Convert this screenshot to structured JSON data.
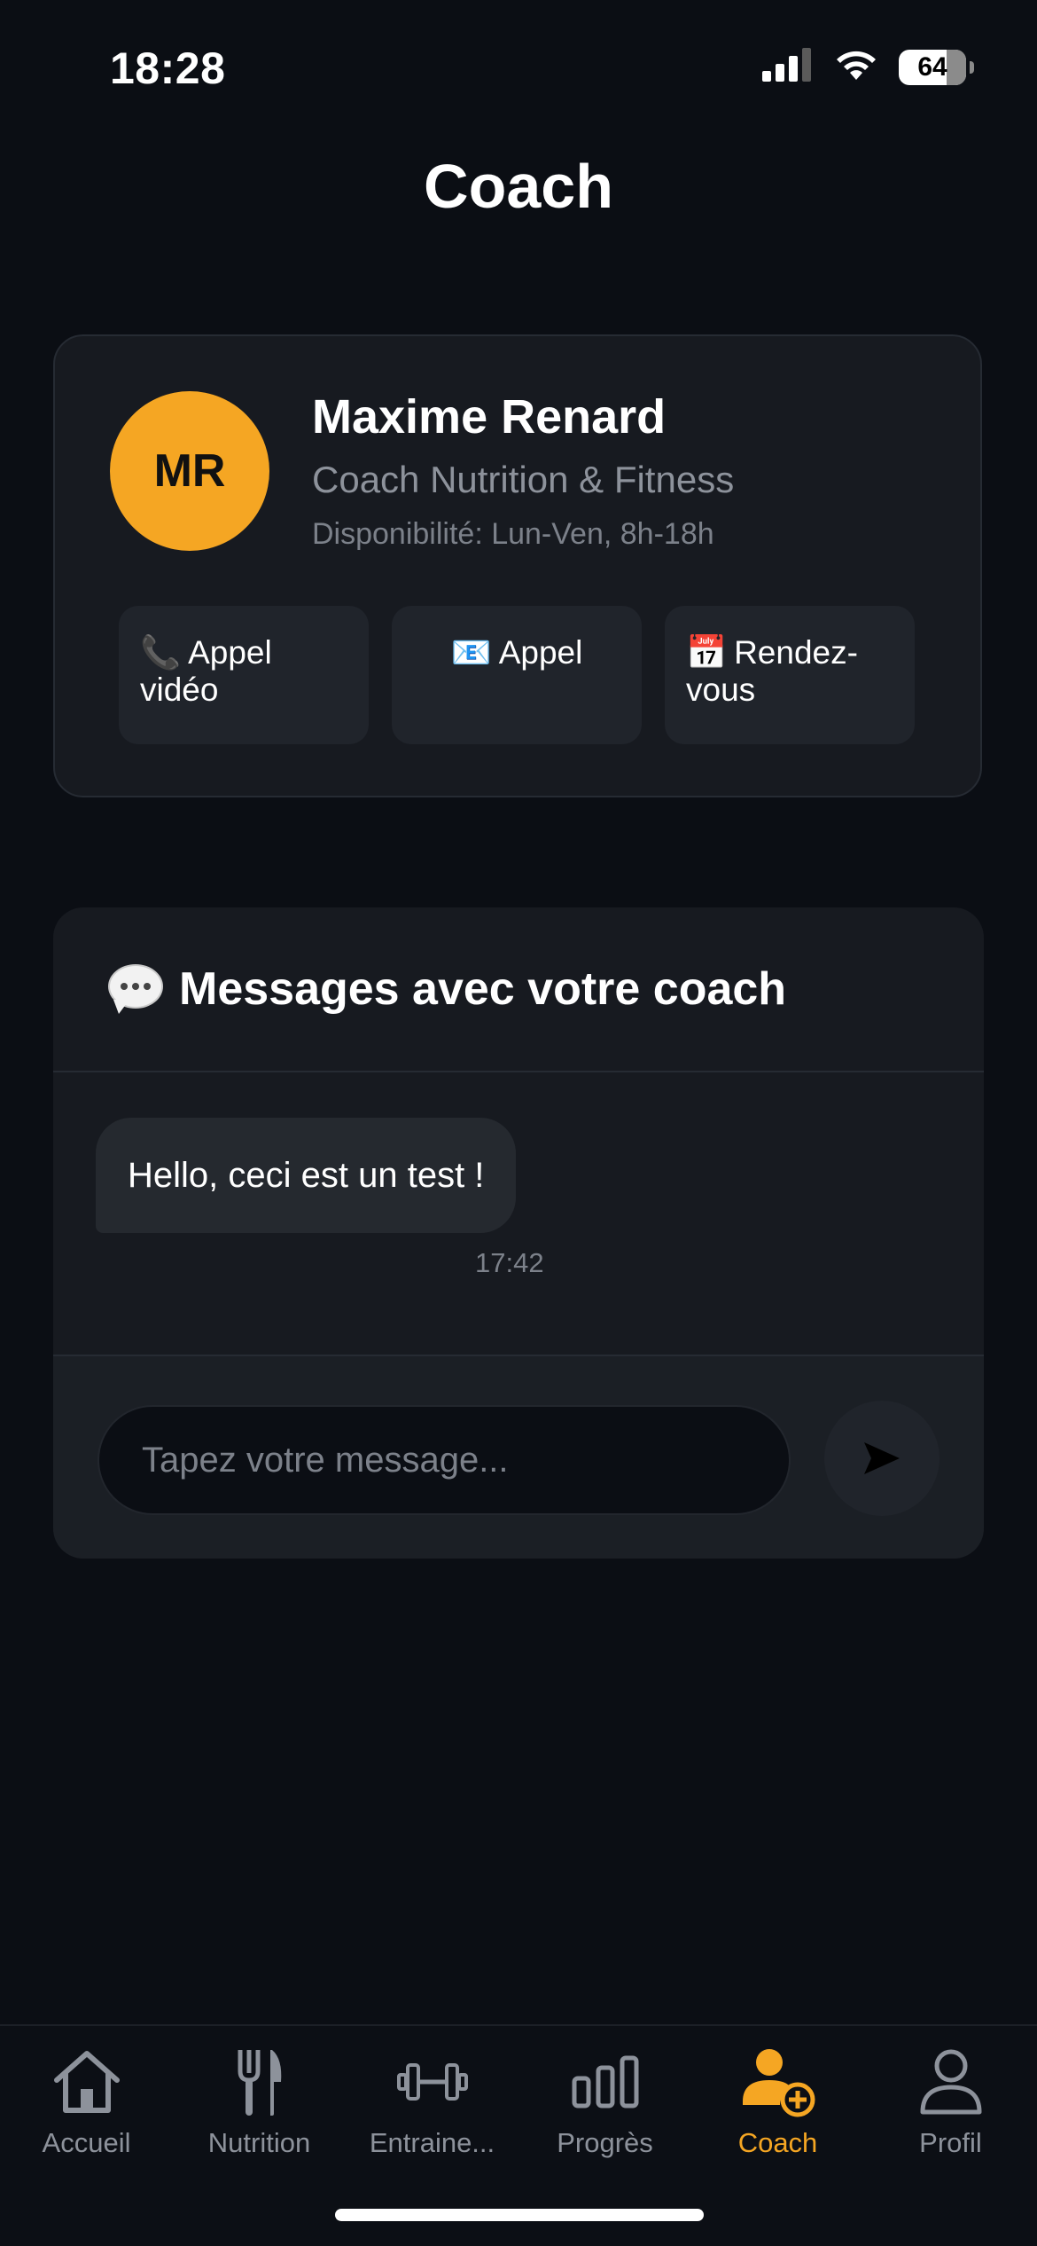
{
  "status": {
    "time": "18:28",
    "battery": "64"
  },
  "page": {
    "title": "Coach"
  },
  "coach": {
    "initials": "MR",
    "name": "Maxime Renard",
    "role": "Coach Nutrition & Fitness",
    "availability": "Disponibilité: Lun-Ven, 8h-18h",
    "avatar_color": "#f5a623",
    "actions": [
      {
        "icon": "📞",
        "label": "Appel vidéo"
      },
      {
        "icon": "📧",
        "label": "Appel"
      },
      {
        "icon": "📅",
        "label": "Rendez-vous"
      }
    ]
  },
  "messages": {
    "title": "Messages avec votre coach",
    "items": [
      {
        "text": "Hello, ceci est un test !",
        "time": "17:42"
      }
    ],
    "input_placeholder": "Tapez votre message..."
  },
  "tabs": [
    {
      "label": "Accueil",
      "icon": "house-icon",
      "active": false
    },
    {
      "label": "Nutrition",
      "icon": "fork-knife-icon",
      "active": false
    },
    {
      "label": "Entraine...",
      "icon": "dumbbell-icon",
      "active": false
    },
    {
      "label": "Progrès",
      "icon": "bar-chart-icon",
      "active": false
    },
    {
      "label": "Coach",
      "icon": "person-plus-icon",
      "active": true
    },
    {
      "label": "Profil",
      "icon": "person-icon",
      "active": false
    }
  ],
  "colors": {
    "accent": "#f5a623",
    "background": "#0b0e14",
    "card": "#171a20"
  }
}
